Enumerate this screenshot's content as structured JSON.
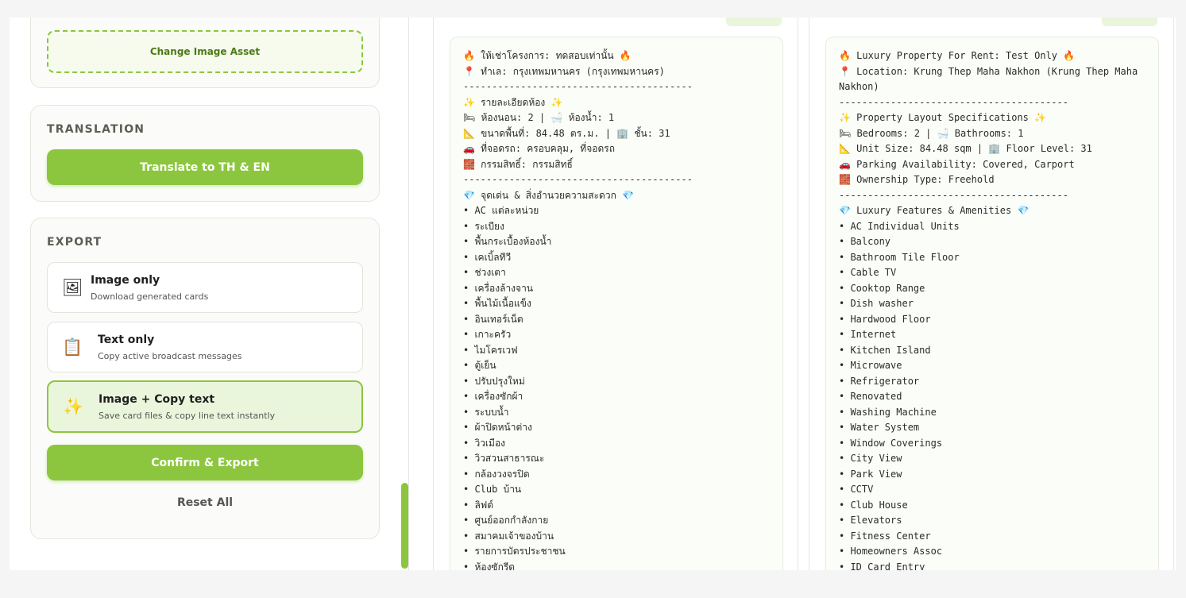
{
  "asset": {
    "change_label": "Change Image Asset"
  },
  "translation": {
    "label": "TRANSLATION",
    "button_label": "Translate to TH & EN"
  },
  "export": {
    "label": "EXPORT",
    "options": [
      {
        "icon": "🖼",
        "icon_name": "image-icon",
        "title": "Image only",
        "subtitle": "Download generated cards"
      },
      {
        "icon": "📋",
        "icon_name": "clipboard-icon",
        "title": "Text only",
        "subtitle": "Copy active broadcast messages"
      },
      {
        "icon": "✨",
        "icon_name": "sparkles-icon",
        "title": "Image + Copy text",
        "subtitle": "Save card files & copy line text instantly"
      }
    ],
    "confirm_label": "Confirm & Export",
    "reset_label": "Reset All"
  },
  "colors": {
    "accent": "#8cc63f",
    "accent_light": "#eaf6dc"
  },
  "messages": {
    "th": [
      "🔥 ให้เช่าโครงการ: ทดสอบเท่านั้น 🔥",
      "📍 ทำเล: กรุงเทพมหานคร (กรุงเทพมหานคร)",
      "----------------------------------------",
      "✨ รายละเอียดห้อง ✨",
      "🛏 ห้องนอน: 2 | 🛁 ห้องน้ำ: 1",
      "📐 ขนาดพื้นที่: 84.48 ตร.ม. | 🏢 ชั้น: 31",
      "🚗 ที่จอดรถ: ครอบคลุม, ที่จอดรถ",
      "🧱 กรรมสิทธิ์: กรรมสิทธิ์",
      "----------------------------------------",
      "💎 จุดเด่น & สิ่งอำนวยความสะดวก 💎",
      "• AC แต่ละหน่วย",
      "• ระเบียง",
      "• พื้นกระเบื้องห้องน้ำ",
      "• เคเบิ้ลทีวี",
      "• ช่วงเตา",
      "• เครื่องล้างจาน",
      "• พื้นไม้เนื้อแข็ง",
      "• อินเทอร์เน็ต",
      "• เกาะครัว",
      "• ไมโครเวฟ",
      "• ตู้เย็น",
      "• ปรับปรุงใหม่",
      "• เครื่องซักผ้า",
      "• ระบบน้ำ",
      "• ผ้าปิดหน้าต่าง",
      "• วิวเมือง",
      "• วิวสวนสาธารณะ",
      "• กล้องวงจรปิด",
      "• Club บ้าน",
      "• ลิฟต์",
      "• ศูนย์ออกกำลังกาย",
      "• สมาคมเจ้าของบ้าน",
      "• รายการบัตรประชาชน",
      "• ห้องซักรีด"
    ],
    "en": [
      "🔥 Luxury Property For Rent: Test Only 🔥",
      "📍 Location: Krung Thep Maha Nakhon (Krung Thep Maha Nakhon)",
      "----------------------------------------",
      "✨ Property Layout Specifications ✨",
      "🛏 Bedrooms: 2 | 🛁 Bathrooms: 1",
      "📐 Unit Size: 84.48 sqm | 🏢 Floor Level: 31",
      "🚗 Parking Availability: Covered, Carport",
      "🧱 Ownership Type: Freehold",
      "----------------------------------------",
      "💎 Luxury Features & Amenities 💎",
      "• AC Individual Units",
      "• Balcony",
      "• Bathroom Tile Floor",
      "• Cable TV",
      "• Cooktop Range",
      "• Dish washer",
      "• Hardwood Floor",
      "• Internet",
      "• Kitchen Island",
      "• Microwave",
      "• Refrigerator",
      "• Renovated",
      "• Washing Machine",
      "• Water System",
      "• Window Coverings",
      "• City View",
      "• Park View",
      "• CCTV",
      "• Club House",
      "• Elevators",
      "• Fitness Center",
      "• Homeowners Assoc",
      "• ID Card Entry"
    ]
  }
}
